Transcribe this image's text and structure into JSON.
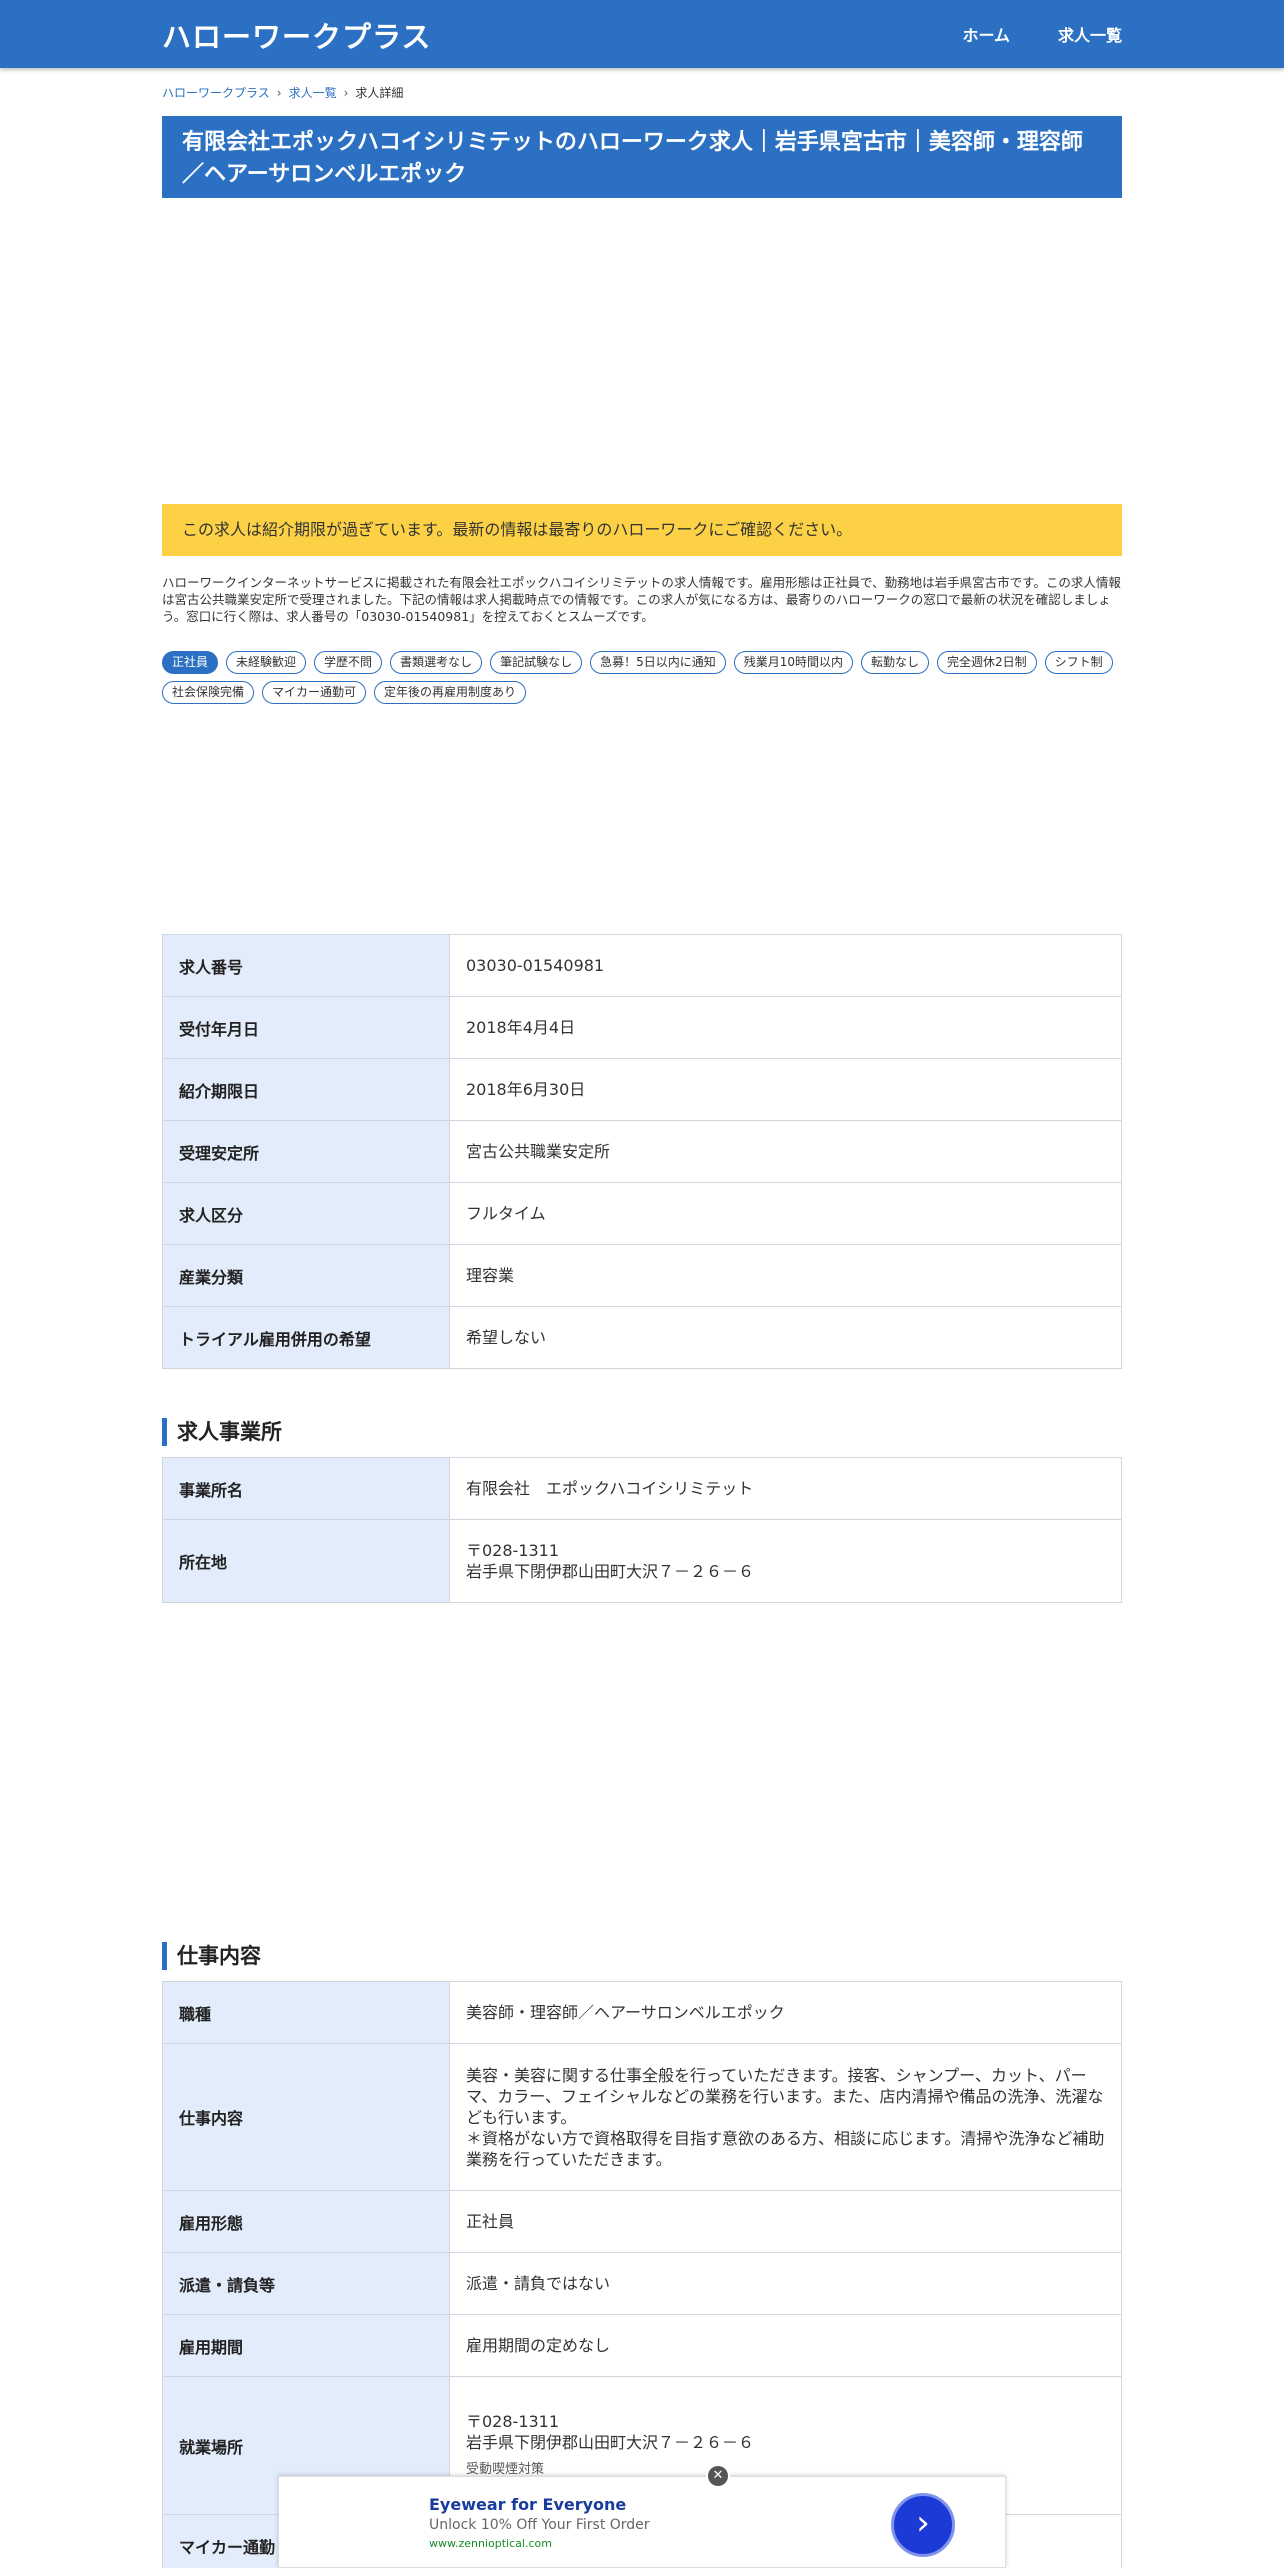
{
  "header": {
    "site_title": "ハローワークプラス",
    "nav": [
      "ホーム",
      "求人一覧"
    ]
  },
  "breadcrumb": {
    "items": [
      "ハローワークプラス",
      "求人一覧",
      "求人詳細"
    ],
    "separator": "›"
  },
  "page_title": "有限会社エポックハコイシリミテットのハローワーク求人｜岩手県宮古市｜美容師・理容師／ヘアーサロンベルエポック",
  "notice": "この求人は紹介期限が過ぎています。最新の情報は最寄りのハローワークにご確認ください。",
  "description": "ハローワークインターネットサービスに掲載された有限会社エポックハコイシリミテットの求人情報です。雇用形態は正社員で、勤務地は岩手県宮古市です。この求人情報は宮古公共職業安定所で受理されました。下記の情報は求人掲載時点での情報です。この求人が気になる方は、最寄りのハローワークの窓口で最新の状況を確認しましょう。窓口に行く際は、求人番号の「03030-01540981」を控えておくとスムーズです。",
  "tags": [
    "正社員",
    "未経験歓迎",
    "学歴不問",
    "書類選考なし",
    "筆記試験なし",
    "急募！5日以内に通知",
    "残業月10時間以内",
    "転勤なし",
    "完全週休2日制",
    "シフト制",
    "社会保険完備",
    "マイカー通勤可",
    "定年後の再雇用制度あり"
  ],
  "basic_info": [
    {
      "label": "求人番号",
      "value": "03030-01540981"
    },
    {
      "label": "受付年月日",
      "value": "2018年4月4日"
    },
    {
      "label": "紹介期限日",
      "value": "2018年6月30日"
    },
    {
      "label": "受理安定所",
      "value": "宮古公共職業安定所"
    },
    {
      "label": "求人区分",
      "value": "フルタイム"
    },
    {
      "label": "産業分類",
      "value": "理容業"
    },
    {
      "label": "トライアル雇用併用の希望",
      "value": "希望しない"
    }
  ],
  "office": {
    "section_title": "求人事業所",
    "name_label": "事業所名",
    "name_value": "有限会社　エポックハコイシリミテット",
    "address_label": "所在地",
    "postal": "〒028-1311",
    "address": "岩手県下閉伊郡山田町大沢７－２６－６"
  },
  "job": {
    "section_title": "仕事内容",
    "rows": {
      "occupation_label": "職種",
      "occupation_value": "美容師・理容師／ヘアーサロンベルエポック",
      "content_label": "仕事内容",
      "content_line1": "美容・美容に関する仕事全般を行っていただきます。接客、シャンプー、カット、パーマ、カラー、フェイシャルなどの業務を行います。また、店内清掃や備品の洗浄、洗濯なども行います。",
      "content_line2": "＊資格がない方で資格取得を目指す意欲のある方、相談に応じます。清掃や洗浄など補助業務を行っていただきます。",
      "employment_label": "雇用形態",
      "employment_value": "正社員",
      "dispatch_label": "派遣・請負等",
      "dispatch_value": "派遣・請負ではない",
      "period_label": "雇用期間",
      "period_value": "雇用期間の定めなし",
      "workplace_label": "就業場所",
      "workplace_postal": "〒028-1311",
      "workplace_address": "岩手県下閉伊郡山田町大沢７－２６－６",
      "workplace_note": "受動喫煙対策",
      "car_label": "マイカー通勤"
    }
  },
  "ad": {
    "title": "Eyewear for Everyone",
    "subtitle": "Unlock 10% Off Your First Order",
    "url": "www.zennioptical.com",
    "close": "✕",
    "button_glyph": "›"
  },
  "colors": {
    "primary": "#2b70c2",
    "notice": "#fcd145",
    "table_header": "#e2ecfa"
  }
}
